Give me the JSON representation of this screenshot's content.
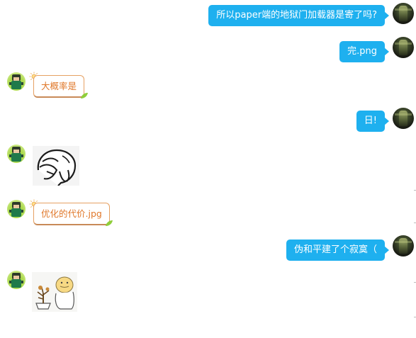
{
  "messages": [
    {
      "side": "right",
      "text": "所以paper端的地狱门加载器是寄了吗?"
    },
    {
      "side": "right",
      "text": "完.png"
    },
    {
      "side": "left",
      "style": "orange",
      "text": "大概率是"
    },
    {
      "side": "right",
      "text": "日!"
    },
    {
      "side": "left",
      "type": "sticker",
      "sticker": "facepalm-sticker"
    },
    {
      "side": "left",
      "style": "orange",
      "text": "优化的代价.jpg"
    },
    {
      "side": "right",
      "text": "伪和平建了个寂寞（"
    },
    {
      "side": "left",
      "type": "sticker",
      "sticker": "plant-cat-sticker"
    }
  ],
  "colors": {
    "blue_bubble": "#1eb0ef",
    "orange_text": "#e0782a",
    "orange_border": "#e6a163"
  },
  "icons": {
    "bubble_decoration": "sun-icon",
    "bubble_corner": "leaf-icon"
  }
}
